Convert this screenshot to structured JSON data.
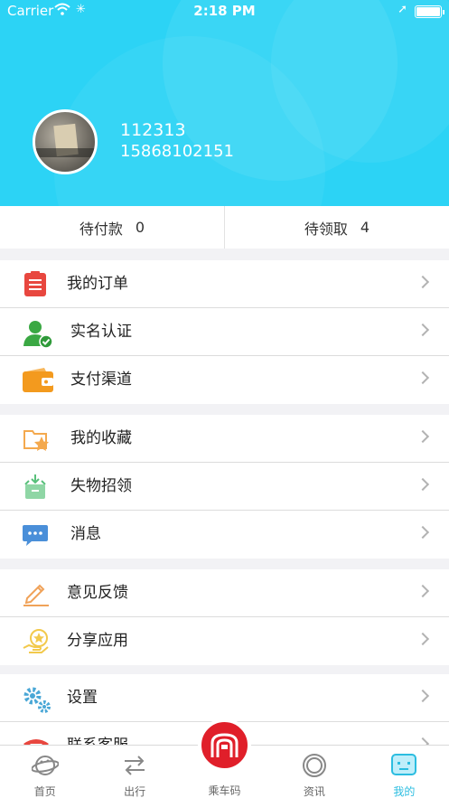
{
  "status_bar": {
    "carrier": "Carrier",
    "time": "2:18 PM"
  },
  "profile": {
    "username": "112313",
    "phone": "15868102151"
  },
  "counts": [
    {
      "label": "待付款",
      "value": "0"
    },
    {
      "label": "待领取",
      "value": "4"
    }
  ],
  "groups": [
    {
      "items": [
        {
          "label": "我的订单",
          "icon": "order-list-icon",
          "color": "#e8473f"
        },
        {
          "label": "实名认证",
          "icon": "user-verified-icon",
          "color": "#3aa843"
        },
        {
          "label": "支付渠道",
          "icon": "wallet-icon",
          "color": "#f39a1e"
        }
      ]
    },
    {
      "items": [
        {
          "label": "我的收藏",
          "icon": "favorite-folder-icon",
          "color": "#f4a94e"
        },
        {
          "label": "失物招领",
          "icon": "lost-found-icon",
          "color": "#58c07a"
        },
        {
          "label": "消息",
          "icon": "message-icon",
          "color": "#4a8fd9"
        }
      ]
    },
    {
      "items": [
        {
          "label": "意见反馈",
          "icon": "feedback-pencil-icon",
          "color": "#f0a259"
        },
        {
          "label": "分享应用",
          "icon": "share-app-icon",
          "color": "#f2c94c"
        }
      ]
    },
    {
      "items": [
        {
          "label": "设置",
          "icon": "settings-gears-icon",
          "color": "#4aa7d6"
        },
        {
          "label": "联系客服",
          "icon": "phone-icon",
          "color": "#e8473f"
        }
      ]
    }
  ],
  "tabbar": {
    "tabs": [
      {
        "label": "首页",
        "icon": "planet-icon"
      },
      {
        "label": "出行",
        "icon": "transfer-arrows-icon"
      },
      {
        "label": "乘车码",
        "icon": "metro-icon"
      },
      {
        "label": "资讯",
        "icon": "news-circle-icon"
      },
      {
        "label": "我的",
        "icon": "mine-face-icon"
      }
    ],
    "active_index": 4
  },
  "colors": {
    "header": "#2cd3f5",
    "accent": "#2bbde0",
    "center_button": "#e01f2a"
  }
}
